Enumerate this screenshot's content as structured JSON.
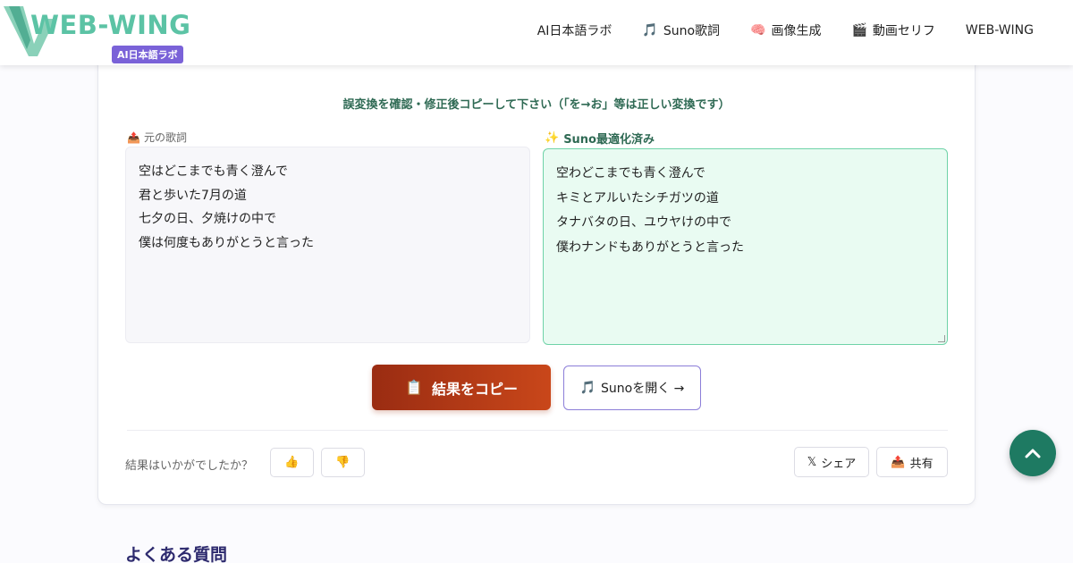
{
  "header": {
    "logo_text": "WEB-WING",
    "logo_badge": "AI日本語ラボ",
    "nav": [
      {
        "label": "AI日本語ラボ",
        "icon": ""
      },
      {
        "label": "Suno歌詞",
        "icon": "🎵"
      },
      {
        "label": "画像生成",
        "icon": "🧠"
      },
      {
        "label": "動画セリフ",
        "icon": "🎬"
      },
      {
        "label": "WEB-WING",
        "icon": ""
      }
    ]
  },
  "main": {
    "instruction": "誤変換を確認・修正後コピーして下さい（「を→お」等は正しい変換です）",
    "original": {
      "label": "元の歌詞",
      "icon": "📤",
      "lines": [
        "空はどこまでも青く澄んで",
        "君と歩いた7月の道",
        "七夕の日、夕焼けの中で",
        "僕は何度もありがとうと言った"
      ]
    },
    "optimized": {
      "label": "Suno最適化済み",
      "icon": "✨",
      "lines": [
        "空わどこまでも青く澄んで",
        "キミとアルいたシチガツの道",
        "タナバタの日、ユウヤけの中で",
        "僕わナンドもありがとうと言った"
      ]
    },
    "copy_button": {
      "icon": "📋",
      "label": "結果をコピー"
    },
    "suno_button": {
      "icon": "🎵",
      "label": "Sunoを開く →"
    },
    "feedback": {
      "question": "結果はいかがでしたか？",
      "up_icon": "👍",
      "down_icon": "👎"
    },
    "share_x": {
      "icon": "𝕏",
      "label": "シェア"
    },
    "share": {
      "icon": "📤",
      "label": "共有"
    }
  },
  "faq_title": "よくある質問",
  "colors": {
    "accent_green": "#1e7a62",
    "copy_button": "#b63a16",
    "purple": "#7a62d8",
    "optimized_bg": "#e9fbf2"
  }
}
